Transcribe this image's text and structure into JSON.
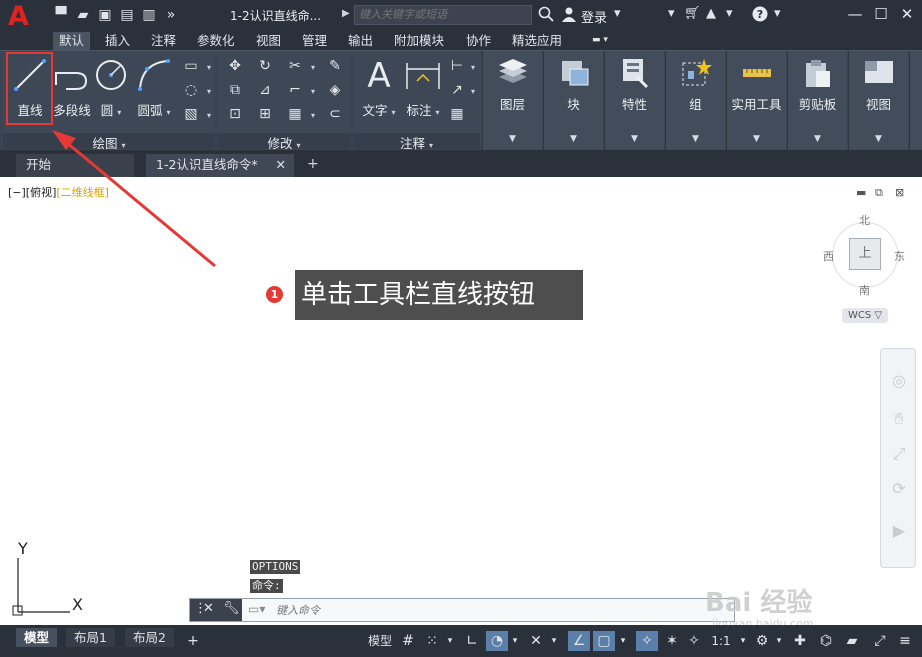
{
  "titlebar": {
    "app_logo": "A",
    "document_title": "1-2认识直线命...",
    "search_placeholder": "键入关键字或短语",
    "login_label": "登录",
    "qat_icons": [
      "new-icon",
      "open-icon",
      "save-icon",
      "saveas-icon",
      "plot-icon",
      "more-icon"
    ]
  },
  "ribbon_tabs": [
    "默认",
    "插入",
    "注释",
    "参数化",
    "视图",
    "管理",
    "输出",
    "附加模块",
    "协作",
    "精选应用"
  ],
  "ribbon": {
    "draw": {
      "title": "绘图",
      "line": "直线",
      "polyline": "多段线",
      "circle": "圆",
      "arc": "圆弧"
    },
    "modify": {
      "title": "修改"
    },
    "annotation": {
      "title": "注释",
      "text": "文字",
      "dimension": "标注"
    },
    "layers": "图层",
    "block": "块",
    "properties": "特性",
    "groups": "组",
    "utilities": "实用工具",
    "clipboard": "剪贴板",
    "view": "视图"
  },
  "file_tabs": {
    "start": "开始",
    "document": "1-2认识直线命令*"
  },
  "viewport": {
    "control": "[−][俯视]",
    "visual_style": "[二维线框]"
  },
  "viewcube": {
    "north": "北",
    "south": "南",
    "east": "东",
    "west": "西",
    "face": "上",
    "wcs": "WCS"
  },
  "ucs": {
    "y": "Y",
    "x": "X"
  },
  "annotation": {
    "number": "1",
    "text": "单击工具栏直线按钮"
  },
  "command": {
    "history_1": "OPTIONS",
    "history_2": "命令:",
    "placeholder": "键入命令"
  },
  "status_bar": {
    "model_tab": "模型",
    "layout1": "布局1",
    "layout2": "布局2",
    "model_button": "模型",
    "scale": "1:1"
  },
  "watermark": {
    "text": "Bai 经验",
    "url": "jingyan.baidu.com"
  }
}
